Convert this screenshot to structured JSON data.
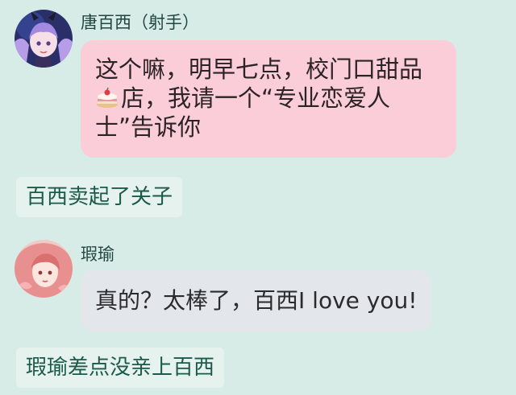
{
  "messages": [
    {
      "sender": "唐百西（射手）",
      "avatar": "twin-tail-girl-avatar",
      "line1": "这个嘛，明早七点，校门口甜品",
      "line2_after_icon": "店，我请一个“专业恋爱人",
      "line3": "士”告诉你",
      "inline_icon": "cake-icon"
    },
    {
      "sender": "瑕瑜",
      "avatar": "pink-hair-girl-avatar",
      "text": "真的？太棒了，百西I love you!"
    }
  ],
  "narration": [
    "百西卖起了关子",
    "瑕瑜差点没亲上百西"
  ],
  "colors": {
    "background": "#d7ece7",
    "pink_bubble": "#fbcdd8",
    "gray_bubble": "#e3e6ea",
    "narration_bg": "#e6f2ee",
    "narration_text": "#1b5a49"
  }
}
